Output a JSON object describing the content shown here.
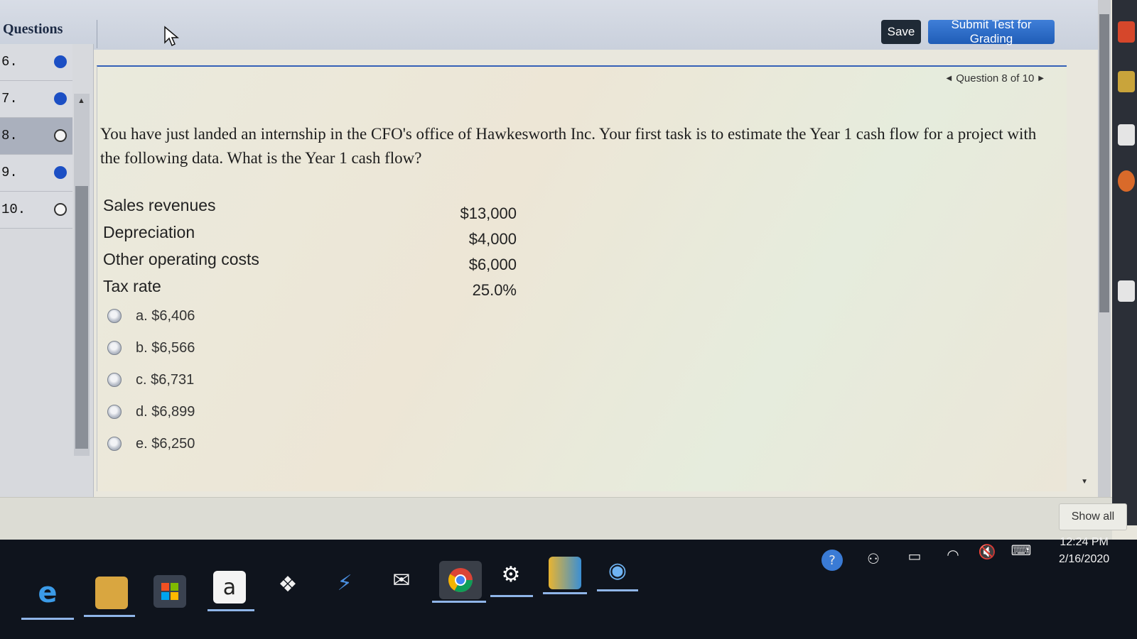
{
  "header": {
    "questions_label": "Questions",
    "save_label": "Save",
    "submit_label": "Submit Test for Grading"
  },
  "sidebar": {
    "items": [
      {
        "number": "6.",
        "status": "answered"
      },
      {
        "number": "7.",
        "status": "answered"
      },
      {
        "number": "8.",
        "status": "unanswered",
        "current": true
      },
      {
        "number": "9.",
        "status": "answered"
      },
      {
        "number": "10.",
        "status": "unanswered"
      }
    ]
  },
  "question": {
    "nav_label": "Question 8 of 10",
    "text": "You have just landed an internship in the CFO's office of Hawkesworth Inc. Your first task is to estimate the Year 1 cash flow for a project with the following data. What is the Year 1 cash flow?",
    "data_rows": [
      {
        "label": "Sales revenues",
        "value": "$13,000"
      },
      {
        "label": "Depreciation",
        "value": "$4,000"
      },
      {
        "label": "Other operating costs",
        "value": "$6,000"
      },
      {
        "label": "Tax rate",
        "value": "25.0%"
      }
    ],
    "choices": [
      {
        "label": "a. $6,406"
      },
      {
        "label": "b. $6,566"
      },
      {
        "label": "c. $6,731"
      },
      {
        "label": "d. $6,899"
      },
      {
        "label": "e. $6,250"
      }
    ]
  },
  "footer": {
    "show_all_label": "Show all"
  },
  "taskbar": {
    "apps": [
      "edge-icon",
      "file-explorer-icon",
      "store-icon",
      "amazon-icon",
      "dropbox-icon",
      "lightning-app-icon",
      "mail-icon",
      "chrome-icon",
      "settings-icon",
      "books-icon",
      "circle-app-icon"
    ],
    "amazon_glyph": "a",
    "time": "12:24 PM",
    "date": "2/16/2020"
  },
  "colors": {
    "accent": "#1f5cb7",
    "answered_dot": "#1c4fc4",
    "taskbar": "#0f141d"
  }
}
